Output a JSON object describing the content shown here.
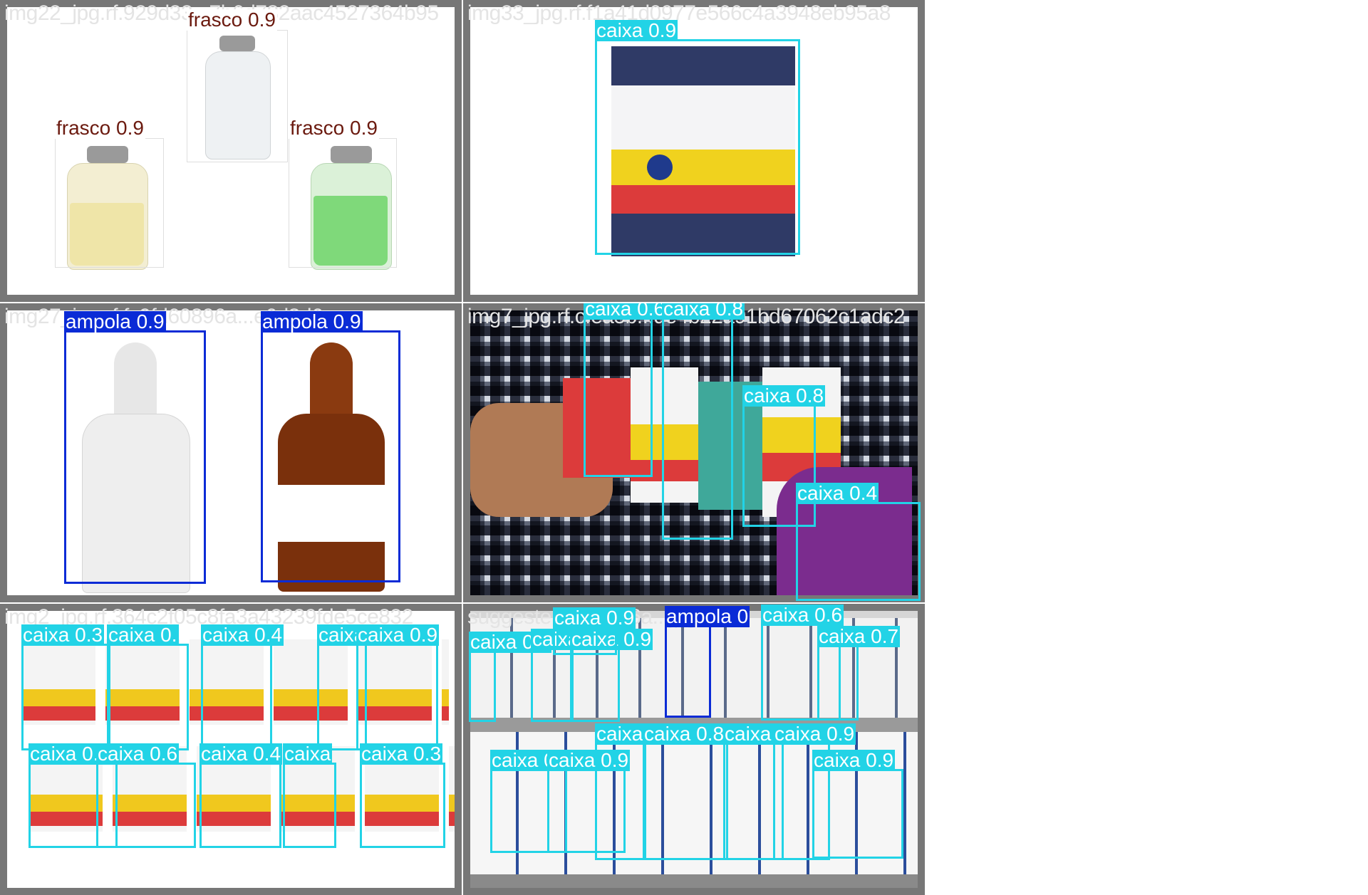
{
  "tiles": [
    {
      "filename": "img22_jpg.rf.929d33...7b6d782aac4527364b95",
      "boxes": [
        {
          "label": "frasco 0.9",
          "cls": "frasco"
        },
        {
          "label": "frasco 0.9",
          "cls": "frasco"
        },
        {
          "label": "frasco 0.9",
          "cls": "frasco"
        }
      ]
    },
    {
      "filename": "img33_jpg.rf.f1a41d0977e566c4a3948eb95a8",
      "boxes": [
        {
          "label": "caixa 0.9",
          "cls": "caixa"
        }
      ]
    },
    {
      "filename": "img27_jpg.rf.fc9fd60896a...e6d8d6a",
      "boxes": [
        {
          "label": "ampola 0.9",
          "cls": "ampola"
        },
        {
          "label": "ampola 0.9",
          "cls": "ampola"
        }
      ]
    },
    {
      "filename": "img7_jpg.rf.cfea5b...de4b22a91bd67062c1adc2",
      "boxes": [
        {
          "label": "caixa 0.6",
          "cls": "caixa"
        },
        {
          "label": "caixa 0.8",
          "cls": "caixa"
        },
        {
          "label": "caixa 0.8",
          "cls": "caixa"
        },
        {
          "label": "caixa 0.4",
          "cls": "caixa"
        }
      ]
    },
    {
      "filename": "img2_jpg.rf.364c2f05c8fa3a43239fde5ce832",
      "boxes": [
        {
          "label": "caixa 0.3",
          "cls": "caixa"
        },
        {
          "label": "caixa 0.",
          "cls": "caixa"
        },
        {
          "label": "caixa 0.4",
          "cls": "caixa"
        },
        {
          "label": "caixa 0.9",
          "cls": "caixa"
        },
        {
          "label": "caixa 0.9",
          "cls": "caixa"
        },
        {
          "label": "caixa 0.",
          "cls": "caixa"
        },
        {
          "label": "caixa 0.6",
          "cls": "caixa"
        },
        {
          "label": "caixa 0.4",
          "cls": "caixa"
        },
        {
          "label": "caixa",
          "cls": "caixa"
        },
        {
          "label": "caixa 0.3",
          "cls": "caixa"
        }
      ]
    },
    {
      "filename": "suggeste...Kv...5v6a...jpg.rf.7f",
      "boxes": [
        {
          "label": "caixa 0.5",
          "cls": "caixa"
        },
        {
          "label": "caixa 0.8",
          "cls": "caixa"
        },
        {
          "label": "caixa 0.9",
          "cls": "caixa"
        },
        {
          "label": "caixa 0.9",
          "cls": "caixa"
        },
        {
          "label": "ampola 0",
          "cls": "ampola"
        },
        {
          "label": "caixa 0.6",
          "cls": "caixa"
        },
        {
          "label": "caixa 0.7",
          "cls": "caixa"
        },
        {
          "label": "caixa",
          "cls": "caixa"
        },
        {
          "label": "caixa 0.8",
          "cls": "caixa"
        },
        {
          "label": "caixa 0.9",
          "cls": "caixa"
        },
        {
          "label": "caixa 0.9",
          "cls": "caixa"
        },
        {
          "label": "caixa 0.3",
          "cls": "caixa"
        },
        {
          "label": "caixa 0.9",
          "cls": "caixa"
        },
        {
          "label": "caixa 0.9",
          "cls": "caixa"
        }
      ]
    }
  ],
  "colors": {
    "caixa": "#22d3e6",
    "ampola": "#0a2bd6",
    "frasco_text": "#6b1a0f",
    "tile_border": "#777777"
  }
}
